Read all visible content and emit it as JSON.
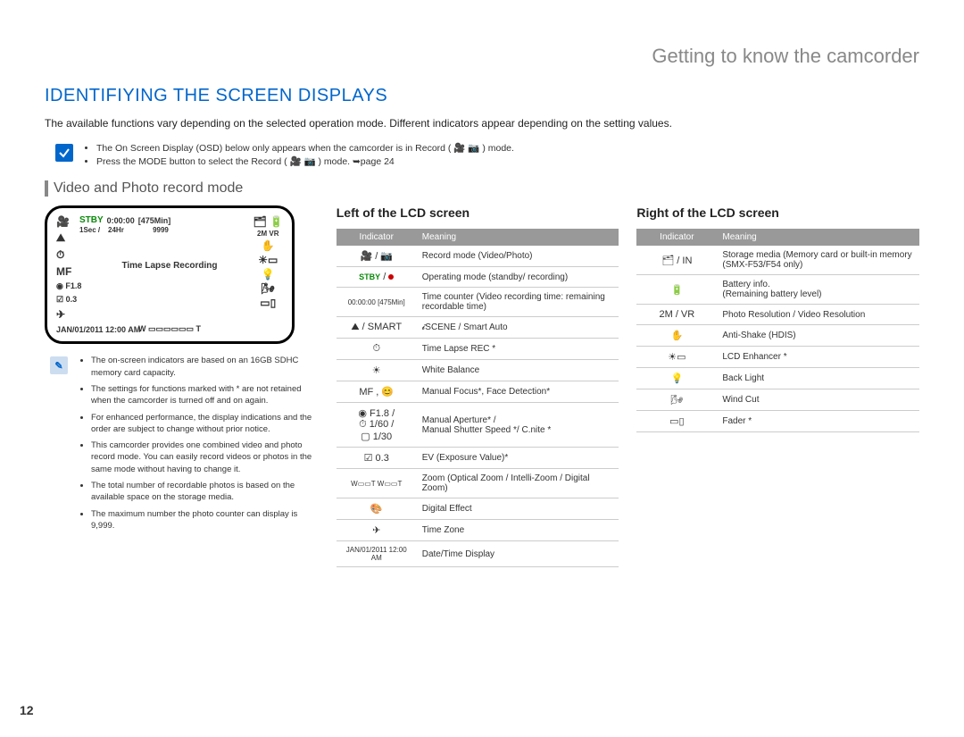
{
  "chapter": "Getting to know the camcorder",
  "section": "IDENTIFIYING THE SCREEN DISPLAYS",
  "intro": "The available functions vary depending on the selected operation mode. Different indicators appear depending on the setting values.",
  "top_notes": [
    "The On Screen Display (OSD) below only appears when the camcorder is in Record ( 🎥 📷 ) mode.",
    "Press the MODE button to select the Record ( 🎥 📷 ) mode. ➥page 24"
  ],
  "subsection": "Video and Photo record mode",
  "lcd": {
    "stby": "STBY",
    "timer": "0:00:00",
    "min": "[475Min]",
    "row2_sec": "1Sec /",
    "row2_hr": "24Hr",
    "row2_count": "9999",
    "center": "Time Lapse Recording",
    "aperture": "F1.8",
    "ev": "0.3",
    "datetime": "JAN/01/2011 12:00 AM",
    "zoom_w": "W",
    "zoom_t": "T"
  },
  "left_notes": [
    "The on-screen indicators are based on an 16GB SDHC memory card capacity.",
    "The settings for functions marked with * are not retained when the camcorder is turned off and on again.",
    "For enhanced performance, the display indications and the order are subject to change without prior notice.",
    "This camcorder provides one combined video and photo record mode. You can easily record videos or photos in the same mode without having to change it.",
    "The total number of recordable photos is based on the available space on the storage media.",
    "The maximum number the photo counter can display is 9,999."
  ],
  "left_screen_title": "Left of the LCD screen",
  "right_screen_title": "Right of the LCD screen",
  "table_headers": {
    "indicator": "Indicator",
    "meaning": "Meaning"
  },
  "left_table": [
    {
      "ind": "🎥 / 📷",
      "meaning": "Record mode (Video/Photo)"
    },
    {
      "ind": "STBY / ●",
      "stby": true,
      "meaning": "Operating mode (standby/ recording)"
    },
    {
      "ind": "00:00:00 [475Min]",
      "small": true,
      "meaning": "Time counter (Video recording time: remaining recordable time)"
    },
    {
      "ind": "⛰ / SMART",
      "meaning": "𝓲SCENE / Smart Auto"
    },
    {
      "ind": "⏱",
      "meaning": "Time Lapse REC *"
    },
    {
      "ind": "☀",
      "meaning": "White Balance"
    },
    {
      "ind": "MF , 😊",
      "meaning": "Manual Focus*, Face Detection*"
    },
    {
      "ind": "◉ F1.8 /\n⏱ 1/60 /\n▢ 1/30",
      "multiline": true,
      "meaning": "Manual Aperture* /\nManual Shutter Speed */ C.nite *"
    },
    {
      "ind": "☑ 0.3",
      "meaning": "EV (Exposure Value)*"
    },
    {
      "ind": "W▭▭T\nW▭▭T",
      "small": true,
      "meaning": "Zoom (Optical Zoom / Intelli-Zoom / Digital Zoom)"
    },
    {
      "ind": "🎨",
      "meaning": "Digital Effect"
    },
    {
      "ind": "✈",
      "meaning": "Time Zone"
    },
    {
      "ind": "JAN/01/2011 12:00 AM",
      "small": true,
      "meaning": "Date/Time Display"
    }
  ],
  "right_table": [
    {
      "ind": "🗂 / IN",
      "meaning": "Storage media (Memory card or built-in memory (SMX-F53/F54 only)"
    },
    {
      "ind": "🔋",
      "meaning": "Battery info.\n(Remaining battery level)"
    },
    {
      "ind": "2M / VR",
      "meaning": "Photo Resolution / Video Resolution"
    },
    {
      "ind": "✋",
      "meaning": "Anti-Shake (HDIS)"
    },
    {
      "ind": "☀▭",
      "meaning": "LCD Enhancer *"
    },
    {
      "ind": "💡",
      "meaning": "Back Light"
    },
    {
      "ind": "🌬",
      "meaning": "Wind Cut"
    },
    {
      "ind": "▭▯",
      "meaning": "Fader *"
    }
  ],
  "page_number": "12"
}
